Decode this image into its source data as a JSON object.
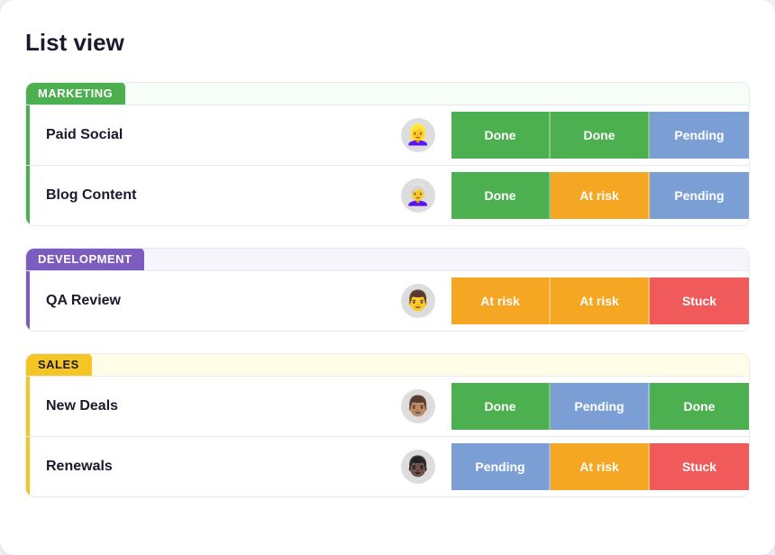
{
  "page": {
    "title": "List view"
  },
  "groups": [
    {
      "id": "marketing",
      "label": "MARKETING",
      "color_class": "bg-marketing",
      "header_bg": "group-header-wrap-marketing",
      "border_class": "group-marketing",
      "rows": [
        {
          "label": "Paid Social",
          "avatar_emoji": "👱‍♀️",
          "statuses": [
            {
              "label": "Done",
              "class": "status-done"
            },
            {
              "label": "Done",
              "class": "status-done"
            },
            {
              "label": "Pending",
              "class": "status-pending"
            }
          ]
        },
        {
          "label": "Blog Content",
          "avatar_emoji": "👩‍🦳",
          "statuses": [
            {
              "label": "Done",
              "class": "status-done"
            },
            {
              "label": "At risk",
              "class": "status-at-risk"
            },
            {
              "label": "Pending",
              "class": "status-pending"
            }
          ]
        }
      ]
    },
    {
      "id": "development",
      "label": "DEVELOPMENT",
      "color_class": "bg-development",
      "header_bg": "group-header-wrap-development",
      "border_class": "group-development",
      "rows": [
        {
          "label": "QA Review",
          "avatar_emoji": "👨",
          "statuses": [
            {
              "label": "At risk",
              "class": "status-at-risk"
            },
            {
              "label": "At risk",
              "class": "status-at-risk"
            },
            {
              "label": "Stuck",
              "class": "status-stuck"
            }
          ]
        }
      ]
    },
    {
      "id": "sales",
      "label": "SALES",
      "color_class": "bg-sales",
      "header_bg": "group-header-wrap-sales",
      "border_class": "group-sales",
      "rows": [
        {
          "label": "New Deals",
          "avatar_emoji": "👨🏽",
          "statuses": [
            {
              "label": "Done",
              "class": "status-done"
            },
            {
              "label": "Pending",
              "class": "status-pending"
            },
            {
              "label": "Done",
              "class": "status-done"
            }
          ]
        },
        {
          "label": "Renewals",
          "avatar_emoji": "👨🏿",
          "statuses": [
            {
              "label": "Pending",
              "class": "status-pending"
            },
            {
              "label": "At risk",
              "class": "status-at-risk"
            },
            {
              "label": "Stuck",
              "class": "status-stuck"
            }
          ]
        }
      ]
    }
  ]
}
